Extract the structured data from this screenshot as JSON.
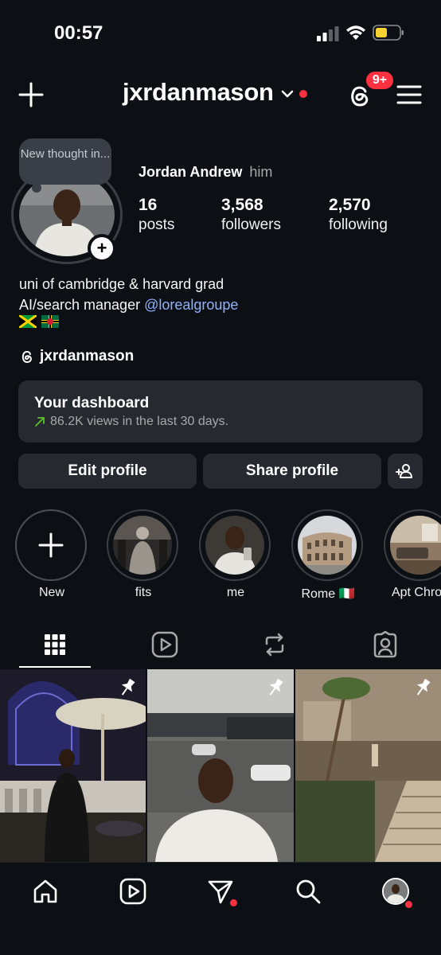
{
  "status_bar": {
    "time": "00:57"
  },
  "header": {
    "username": "jxrdanmason",
    "notification_badge": "9+"
  },
  "note": {
    "text": "New thought in..."
  },
  "profile": {
    "name": "Jordan Andrew",
    "pronouns": "him",
    "stats": [
      {
        "value": "16",
        "label": "posts"
      },
      {
        "value": "3,568",
        "label": "followers"
      },
      {
        "value": "2,570",
        "label": "following"
      }
    ],
    "bio_line1": "uni of cambridge & harvard grad",
    "bio_line2_prefix": "AI/search manager ",
    "bio_mention": "@lorealgroupe",
    "flags": [
      "jamaica-flag",
      "dominica-flag"
    ],
    "threads_handle": "jxrdanmason"
  },
  "dashboard": {
    "title": "Your dashboard",
    "subtitle": "86.2K views in the last 30 days."
  },
  "actions": {
    "edit_profile": "Edit profile",
    "share_profile": "Share profile"
  },
  "highlights": [
    {
      "label": "New"
    },
    {
      "label": "fits"
    },
    {
      "label": "me"
    },
    {
      "label": "Rome 🇮🇹"
    },
    {
      "label": "Apt Chron"
    }
  ],
  "tabs": [
    "grid-icon",
    "reels-icon",
    "reposts-icon",
    "tagged-icon"
  ],
  "bottom_nav": [
    "home-icon",
    "reels-icon",
    "messages-icon",
    "search-icon",
    "profile-avatar"
  ],
  "colors": {
    "background": "#0c1014",
    "surface": "#262a30",
    "accent_red": "#ff3040",
    "mention_blue": "#8fb2ff",
    "positive_green": "#58c322"
  }
}
